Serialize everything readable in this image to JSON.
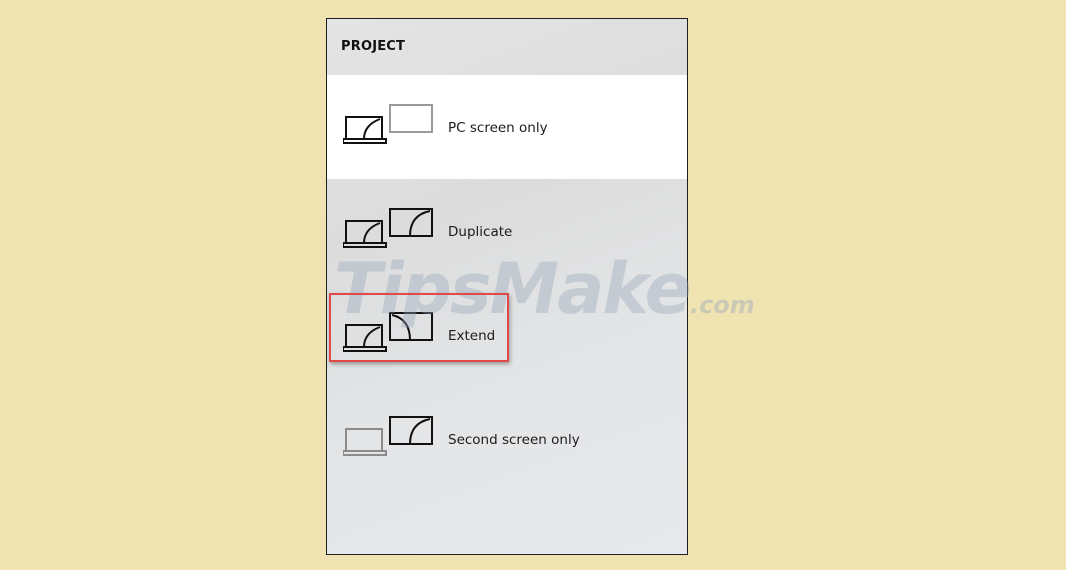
{
  "panel": {
    "title": "PROJECT"
  },
  "options": [
    {
      "label": "PC screen only",
      "selected": true,
      "icon": "pc-screen-only-icon"
    },
    {
      "label": "Duplicate",
      "selected": false,
      "icon": "duplicate-icon"
    },
    {
      "label": "Extend",
      "selected": false,
      "icon": "extend-icon"
    },
    {
      "label": "Second screen only",
      "selected": false,
      "icon": "second-screen-only-icon"
    }
  ],
  "watermark": {
    "brand": "TipsMake",
    "suffix": ".com"
  },
  "colors": {
    "background": "#efe3b1",
    "highlight_border": "#e24a4a",
    "selected_row": "#ffffff",
    "dimmed_icon": "#8c8c8c"
  }
}
